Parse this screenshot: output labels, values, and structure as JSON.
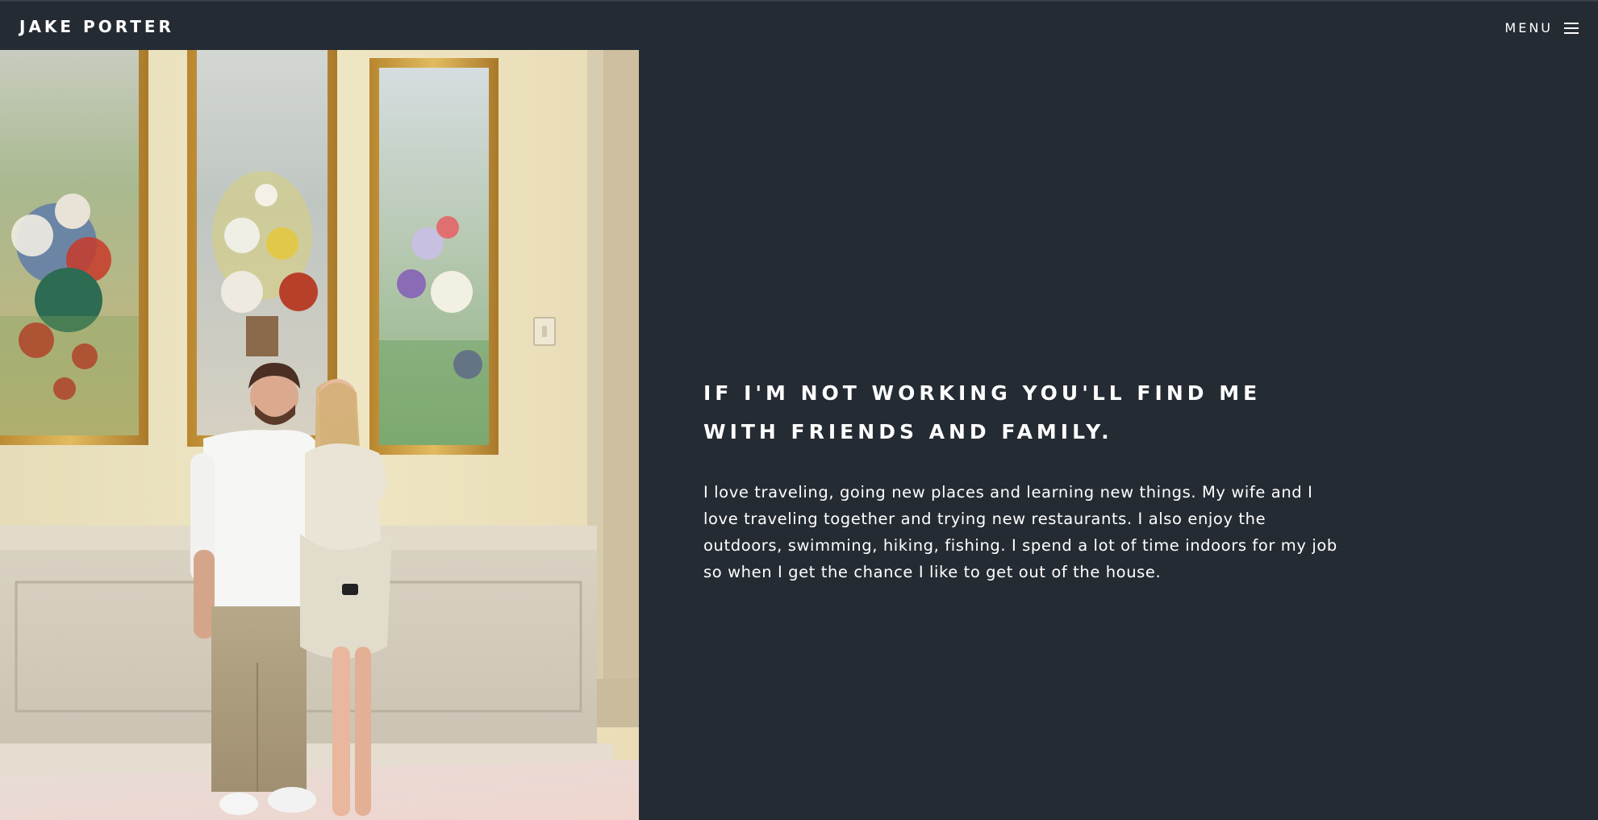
{
  "header": {
    "brand": "JAKE PORTER",
    "menu_label": "MENU",
    "menu_icon": "hamburger-icon"
  },
  "photo": {
    "subject": "photo-couple-gallery"
  },
  "about": {
    "heading": "IF I'M NOT WORKING YOU'LL FIND ME WITH FRIENDS AND FAMILY.",
    "body": "I love traveling, going new places and learning new things. My wife and I love traveling together and trying new restaurants. I also enjoy the outdoors, swimming, hiking, fishing. I spend a lot of time indoors for my job so when I get the chance I like to get out of the house."
  },
  "colors": {
    "background": "#252b33",
    "text": "#ffffff"
  }
}
